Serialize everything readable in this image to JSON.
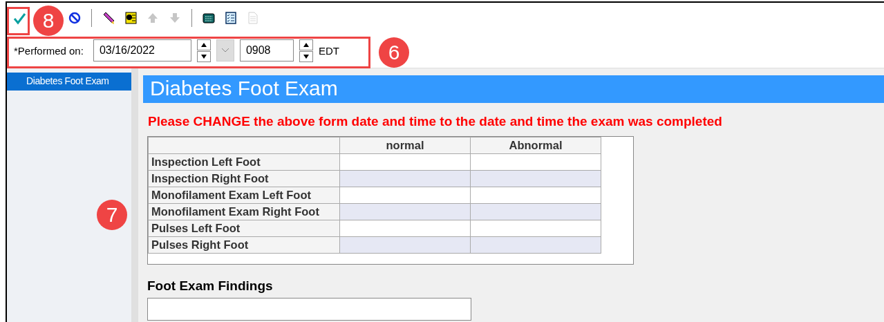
{
  "toolbar": {
    "buttons": [
      {
        "kind": "check",
        "disabled": false
      },
      {
        "kind": "cancel",
        "disabled": false
      },
      {
        "kind": "separator"
      },
      {
        "kind": "pen",
        "disabled": false
      },
      {
        "kind": "card",
        "disabled": false
      },
      {
        "kind": "up",
        "disabled": true
      },
      {
        "kind": "down",
        "disabled": true
      },
      {
        "kind": "separator"
      },
      {
        "kind": "calculator",
        "disabled": false
      },
      {
        "kind": "checklist",
        "disabled": false
      },
      {
        "kind": "document",
        "disabled": true
      }
    ]
  },
  "performed": {
    "label": "*Performed on:",
    "date": "03/16/2022",
    "time": "0908",
    "timezone": "EDT"
  },
  "sidebar": {
    "items": [
      {
        "label": "Diabetes Foot Exam",
        "selected": true
      }
    ]
  },
  "form": {
    "title": "Diabetes Foot Exam",
    "instruction": "Please CHANGE the above form date and time to the date and time  the exam was completed",
    "grid": {
      "columns": [
        "normal",
        "Abnormal"
      ],
      "rows": [
        "Inspection Left Foot",
        "Inspection Right Foot",
        "Monofilament Exam Left Foot",
        "Monofilament Exam Right Foot",
        "Pulses Left Foot",
        "Pulses Right Foot"
      ]
    },
    "findings": {
      "label": "Foot Exam Findings"
    }
  },
  "callouts": [
    {
      "label": "8"
    },
    {
      "label": "6"
    },
    {
      "label": "7"
    }
  ]
}
